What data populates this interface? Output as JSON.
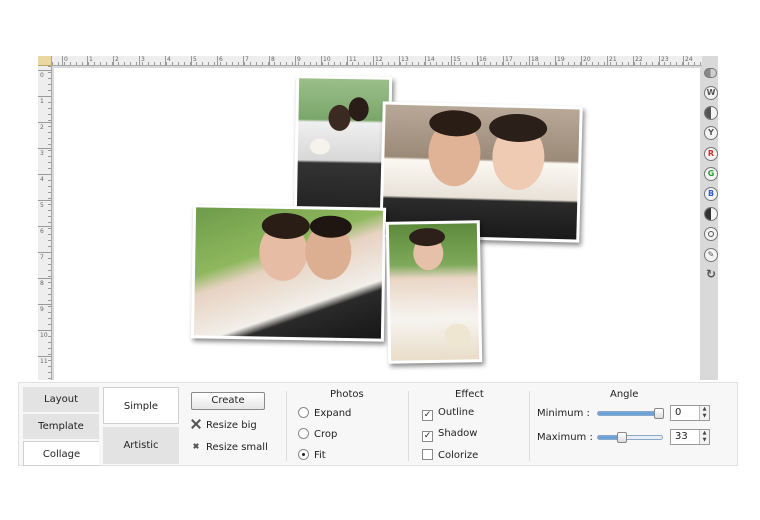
{
  "ruler": {
    "top_ticks": [
      "0",
      "1",
      "2",
      "3",
      "4",
      "5",
      "6",
      "7",
      "8",
      "9",
      "10",
      "11",
      "12",
      "13",
      "14",
      "15",
      "16",
      "17",
      "18",
      "19",
      "20",
      "21",
      "22",
      "23",
      "24"
    ],
    "left_ticks": [
      "0",
      "1",
      "2",
      "3",
      "4",
      "5",
      "6",
      "7",
      "8",
      "9",
      "10",
      "11"
    ]
  },
  "right_tools": [
    "W",
    "",
    "Y",
    "R",
    "G",
    "B",
    "",
    "",
    ""
  ],
  "tool_icons": [
    "brightness-icon",
    "contrast-icon",
    "yellow-channel-icon",
    "red-channel-icon",
    "green-channel-icon",
    "blue-channel-icon",
    "half-circle-icon",
    "target-icon",
    "pen-icon",
    "refresh-icon"
  ],
  "colors": {
    "red": "#d03030",
    "green": "#2e9a3a",
    "blue": "#3060c8",
    "accent": "#6aa3d6"
  },
  "panel": {
    "vertical_tabs": [
      "Layout",
      "Template",
      "Collage"
    ],
    "active_vertical_tab": "Collage",
    "mode_tabs": [
      "Simple",
      "Artistic"
    ],
    "active_mode_tab": "Simple",
    "create_label": "Create",
    "resize_big_label": "Resize big",
    "resize_small_label": "Resize small",
    "photos": {
      "title": "Photos",
      "options": [
        "Expand",
        "Crop",
        "Fit"
      ],
      "selected": "Fit"
    },
    "effect": {
      "title": "Effect",
      "options": [
        {
          "label": "Outline",
          "checked": true
        },
        {
          "label": "Shadow",
          "checked": true
        },
        {
          "label": "Colorize",
          "checked": false
        }
      ]
    },
    "angle": {
      "title": "Angle",
      "minimum_label": "Minimum :",
      "maximum_label": "Maximum :",
      "minimum_value": "0",
      "maximum_value": "33",
      "minimum_fraction": 1.0,
      "maximum_fraction": 0.38
    }
  }
}
